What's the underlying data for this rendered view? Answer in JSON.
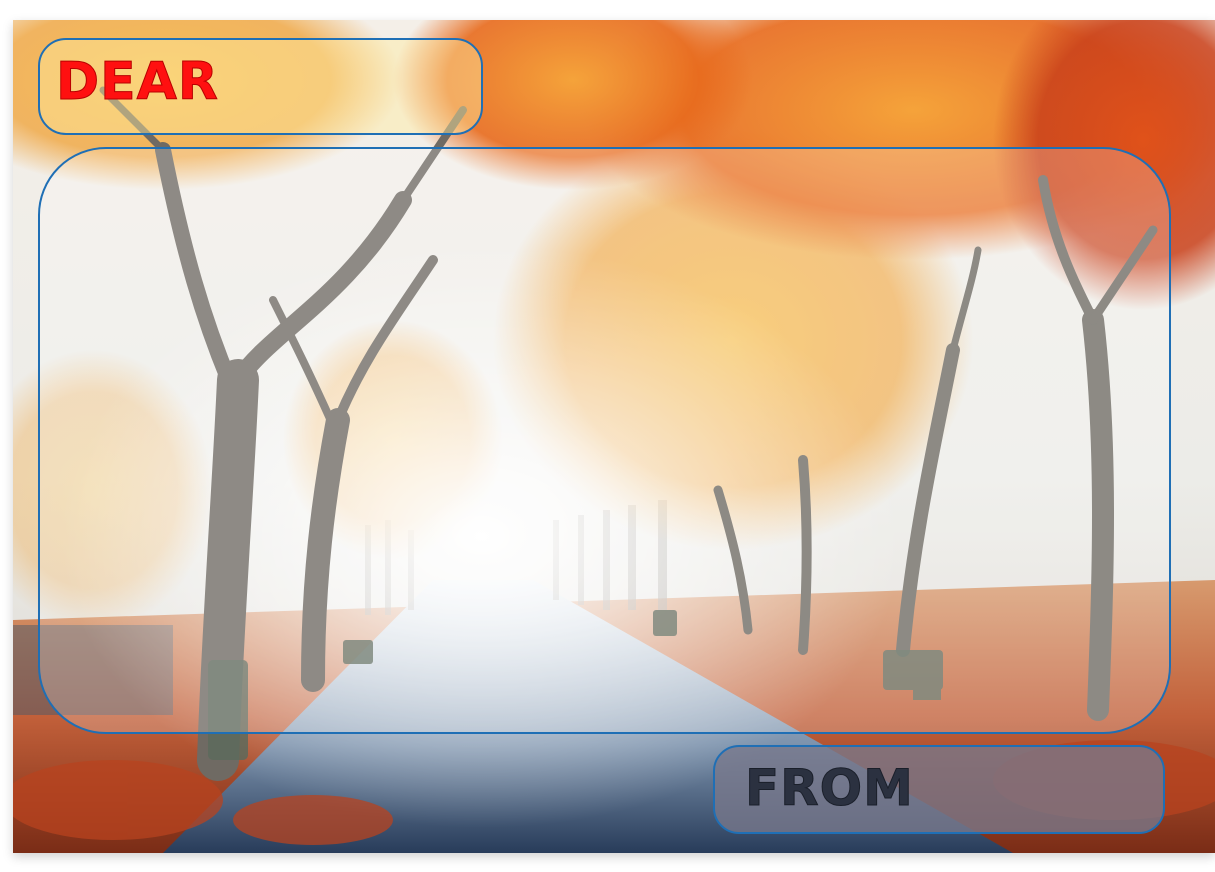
{
  "card": {
    "dear_label": "DEAR",
    "message_value": "",
    "from_label": "FROM"
  },
  "colors": {
    "dear_text": "#ff1010",
    "from_text": "#2b3140",
    "field_border": "#1f6fb5"
  },
  "background": {
    "scene": "autumn-park-alley-in-fog",
    "icon": "autumn-trees-image"
  }
}
